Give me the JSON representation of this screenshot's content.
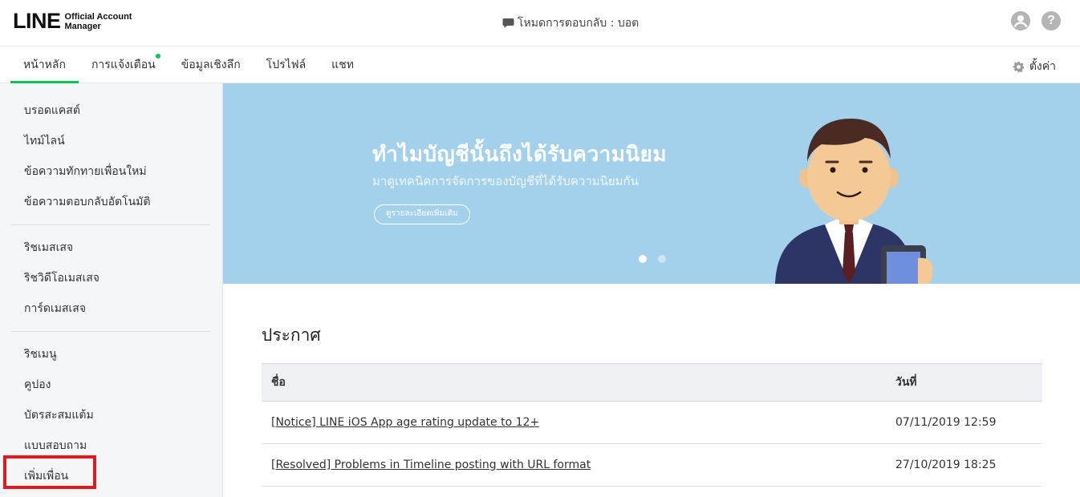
{
  "header": {
    "logo_main": "LINE",
    "logo_sub_1": "Official Account",
    "logo_sub_2": "Manager",
    "mode_text": "โหมดการตอบกลับ : บอต",
    "icons": [
      "account-icon",
      "help-icon"
    ],
    "help_glyph": "?"
  },
  "nav": {
    "tabs": [
      {
        "label": "หน้าหลัก",
        "active": true
      },
      {
        "label": "การแจ้งเตือน",
        "badge": true
      },
      {
        "label": "ข้อมูลเชิงลึก"
      },
      {
        "label": "โปรไฟล์"
      },
      {
        "label": "แชท"
      }
    ],
    "settings_label": "ตั้งค่า",
    "accent_color": "#06c755"
  },
  "sidebar": {
    "groups": [
      [
        "บรอดแคสต์",
        "ไทม์ไลน์",
        "ข้อความทักทายเพื่อนใหม่",
        "ข้อความตอบกลับอัตโนมัติ"
      ],
      [
        "ริชเมสเสจ",
        "ริชวิดีโอเมสเสจ",
        "การ์ดเมสเสจ"
      ],
      [
        "ริชเมนู",
        "คูปอง",
        "บัตรสะสมแต้ม",
        "แบบสอบถาม",
        "เพิ่มเพื่อน"
      ]
    ],
    "highlighted_item": "เพิ่มเพื่อน",
    "highlight_color": "#e0191f"
  },
  "banner": {
    "title": "ทำไมบัญชีนั้นถึงได้รับความนิยม",
    "subtitle": "มาดูเทคนิคการจัดการของบัญชีที่ได้รับความนิยมกัน",
    "button_label": "ดูรายละเอียดเพิ่มเติม",
    "slide_count": 2,
    "active_slide": 1,
    "background": "#a3d1ec"
  },
  "announcements": {
    "title": "ประกาศ",
    "columns": [
      "ชื่อ",
      "วันที่"
    ],
    "rows": [
      {
        "name": "[Notice] LINE iOS App age rating update to 12+",
        "date": "07/11/2019 12:59"
      },
      {
        "name": "[Resolved] Problems in Timeline posting with URL format",
        "date": "27/10/2019 18:25"
      }
    ]
  }
}
